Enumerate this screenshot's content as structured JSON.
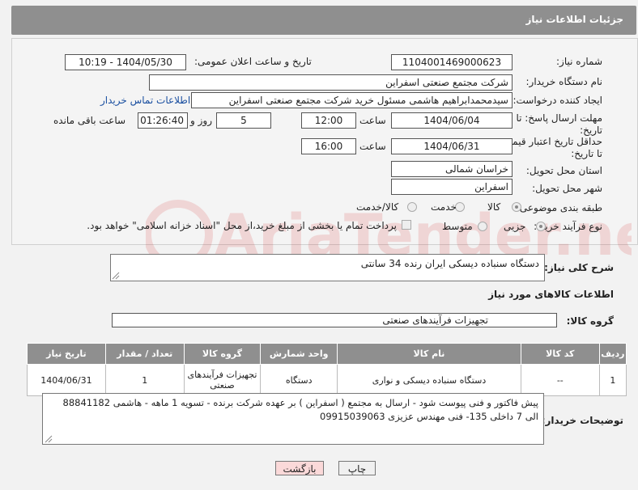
{
  "header": {
    "title": "جزئیات اطلاعات نیاز"
  },
  "form": {
    "need_number_label": "شماره نیاز:",
    "need_number": "1104001469000623",
    "announce_label": "تاریخ و ساعت اعلان عمومی:",
    "announce_value": "1404/05/30 - 10:19",
    "buyer_org_label": "نام دستگاه خریدار:",
    "buyer_org": "شرکت مجتمع صنعتی اسفراین",
    "creator_label": "ایجاد کننده درخواست:",
    "creator": "سیدمحمدابراهیم هاشمی مسئول خرید شرکت مجتمع صنعتی اسفراین",
    "contact_link": "اطلاعات تماس خریدار",
    "reply_deadline_label_1": "مهلت ارسال پاسخ: تا",
    "reply_deadline_label_2": "تاریخ:",
    "reply_date": "1404/06/04",
    "time_label": "ساعت",
    "reply_time": "12:00",
    "days": "5",
    "days_label": "روز و",
    "remaining": "01:26:40",
    "remaining_label": "ساعت باقی مانده",
    "price_deadline_label_1": "حداقل تاریخ اعتبار قیمت:",
    "price_deadline_label_2": "تا تاریخ:",
    "price_date": "1404/06/31",
    "price_time": "16:00",
    "province_label": "استان محل تحویل:",
    "province": "خراسان شمالی",
    "city_label": "شهر محل تحویل:",
    "city": "اسفراین",
    "category_label": "طبقه بندی موضوعی:",
    "category_options": [
      "کالا",
      "خدمت",
      "کالا/خدمت"
    ],
    "process_label": "نوع فرآیند خرید :",
    "process_options": [
      "جزیی",
      "متوسط"
    ],
    "payment_note": "پرداخت تمام یا بخشی از مبلغ خرید،از محل \"اسناد خزانه اسلامی\" خواهد بود."
  },
  "summary": {
    "label": "شرح کلی نیاز:",
    "value": "دستگاه سنباده دیسکی ایران رنده 34 سانتی"
  },
  "goods": {
    "section_title": "اطلاعات کالاهای مورد نیاز",
    "group_label": "گروه کالا:",
    "group_value": "تجهیزات فرآیندهای صنعتی",
    "columns": [
      "ردیف",
      "کد کالا",
      "نام کالا",
      "واحد شمارش",
      "گروه کالا",
      "تعداد / مقدار",
      "تاریخ نیاز"
    ],
    "rows": [
      {
        "row": "1",
        "code": "--",
        "name": "دستگاه سنباده دیسکی و نواری",
        "unit": "دستگاه",
        "group": "تجهیزات فرآیندهای صنعتی",
        "qty": "1",
        "date": "1404/06/31"
      }
    ]
  },
  "buyer_notes": {
    "label": "توضیحات خریدار:",
    "line1": "پیش فاکتور و فنی پیوست شود - ارسال به مجتمع ( اسفراین ) بر عهده شرکت برنده - تسویه 1 ماهه - هاشمی 88841182",
    "line2": "الی 7 داخلی 135- فنی مهندس عزیزی 09915039063"
  },
  "buttons": {
    "print": "چاپ",
    "back": "بازگشت"
  },
  "watermark": "AriaTender.net"
}
